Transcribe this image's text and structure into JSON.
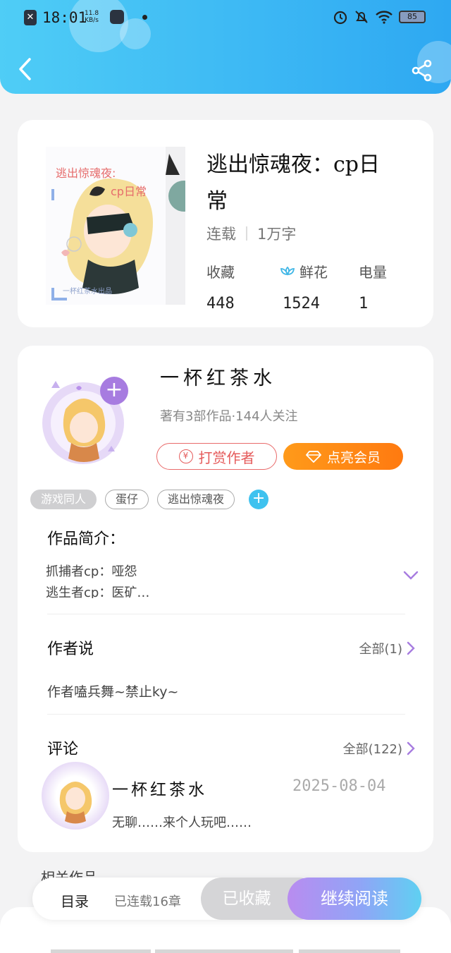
{
  "status_bar": {
    "time": "18:01",
    "net_speed_value": "11.8",
    "net_speed_unit": "KB/s",
    "battery": "85"
  },
  "book": {
    "cover_text": "逃出惊魂夜:",
    "cover_subtext": "cp日常",
    "cover_credit": "一杯红茶水出品",
    "title": "逃出惊魂夜：cp日常",
    "status": "连载",
    "word_count": "1万字",
    "stats": {
      "favorites_label": "收藏",
      "favorites_value": "448",
      "flowers_label": "鲜花",
      "flowers_value": "1524",
      "power_label": "电量",
      "power_value": "1"
    }
  },
  "author": {
    "name": "一杯红茶水",
    "summary": "著有3部作品·144人关注",
    "tip_label": "打赏作者",
    "vip_label": "点亮会员"
  },
  "tags": [
    "游戏同人",
    "蛋仔",
    "逃出惊魂夜"
  ],
  "intro": {
    "heading": "作品简介：",
    "line1": "抓捕者cp：哑怨",
    "line2": "逃生者cp：医矿…"
  },
  "author_says": {
    "heading": "作者说",
    "all_label": "全部(1)",
    "text": "作者嗑兵舞~禁止ky~"
  },
  "comments": {
    "heading": "评论",
    "all_label": "全部(122)",
    "items": [
      {
        "user": "一杯红茶水",
        "date": "2025-08-04",
        "text": "无聊……来个人玩吧……"
      }
    ]
  },
  "related": {
    "heading": "相关作品"
  },
  "bottom_bar": {
    "catalog_label": "目录",
    "progress_label": "已连载16章",
    "collected_label": "已收藏",
    "read_label": "继续阅读"
  },
  "colors": {
    "header_start": "#4fcdf6",
    "header_end": "#2ea8f2",
    "accent_purple": "#a77ce0",
    "tip_red": "#e55b5b",
    "vip_orange": "#ff8a12",
    "tag_add_blue": "#3fc2ef"
  }
}
